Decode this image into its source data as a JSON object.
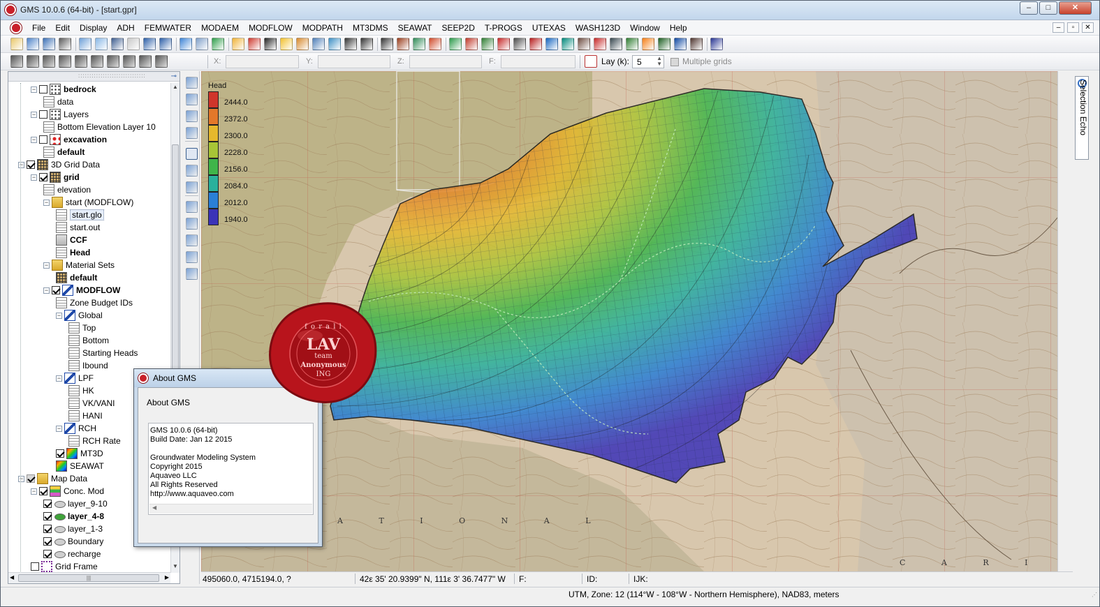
{
  "window": {
    "title": "GMS 10.0.6 (64-bit) - [start.gpr]",
    "controls": [
      "–",
      "□",
      "✕"
    ]
  },
  "menu": {
    "items": [
      "File",
      "Edit",
      "Display",
      "ADH",
      "FEMWATER",
      "MODAEM",
      "MODFLOW",
      "MODPATH",
      "MT3DMS",
      "SEAWAT",
      "SEEP2D",
      "T-PROGS",
      "UTEXAS",
      "WASH123D",
      "Window",
      "Help"
    ],
    "mdi_controls": [
      "–",
      "▫",
      "✕"
    ]
  },
  "coord_bar": {
    "x_label": "X:",
    "y_label": "Y:",
    "z_label": "Z:",
    "f_label": "F:",
    "lay_label": "Lay (k):",
    "lay_value": "5",
    "multiple_grids_label": "Multiple grids"
  },
  "tree": {
    "items": [
      {
        "label": "bedrock",
        "bold": true,
        "icon": "dots-icon",
        "checked": false
      },
      {
        "label": "data",
        "bold": false,
        "icon": "document-icon"
      },
      {
        "label": "Layers",
        "bold": false,
        "icon": "dots-icon",
        "checked": false
      },
      {
        "label": "Bottom Elevation Layer 10",
        "bold": false,
        "icon": "document-icon"
      },
      {
        "label": "excavation",
        "bold": true,
        "icon": "scatter-red-icon",
        "checked": false
      },
      {
        "label": "default",
        "bold": true,
        "icon": "document-icon"
      },
      {
        "label": "3D Grid Data",
        "bold": false,
        "icon": "grid-folder-icon",
        "checked": true
      },
      {
        "label": "grid",
        "bold": true,
        "icon": "grid-icon",
        "checked": true
      },
      {
        "label": "elevation",
        "bold": false,
        "icon": "document-icon"
      },
      {
        "label": "start (MODFLOW)",
        "bold": false,
        "icon": "folder-lock-icon"
      },
      {
        "label": "start.glo",
        "bold": false,
        "icon": "document-icon",
        "selected": true
      },
      {
        "label": "start.out",
        "bold": false,
        "icon": "document-icon"
      },
      {
        "label": "CCF",
        "bold": true,
        "icon": "ccf-icon"
      },
      {
        "label": "Head",
        "bold": true,
        "icon": "document-icon"
      },
      {
        "label": "Material Sets",
        "bold": false,
        "icon": "folder-icon"
      },
      {
        "label": "default",
        "bold": true,
        "icon": "material-grid-icon"
      },
      {
        "label": "MODFLOW",
        "bold": true,
        "icon": "modflow-icon",
        "checked": true
      },
      {
        "label": "Zone Budget IDs",
        "bold": false,
        "icon": "document-icon"
      },
      {
        "label": "Global",
        "bold": false,
        "icon": "modflow-package-icon"
      },
      {
        "label": "Top",
        "bold": false,
        "icon": "document-icon"
      },
      {
        "label": "Bottom",
        "bold": false,
        "icon": "document-icon"
      },
      {
        "label": "Starting Heads",
        "bold": false,
        "icon": "document-icon"
      },
      {
        "label": "Ibound",
        "bold": false,
        "icon": "document-icon"
      },
      {
        "label": "LPF",
        "bold": false,
        "icon": "modflow-package-icon"
      },
      {
        "label": "HK",
        "bold": false,
        "icon": "document-icon"
      },
      {
        "label": "VK/VANI",
        "bold": false,
        "icon": "document-icon"
      },
      {
        "label": "HANI",
        "bold": false,
        "icon": "document-icon"
      },
      {
        "label": "RCH",
        "bold": false,
        "icon": "modflow-package-icon"
      },
      {
        "label": "RCH Rate",
        "bold": false,
        "icon": "document-icon"
      },
      {
        "label": "MT3D",
        "bold": false,
        "icon": "mt3d-icon",
        "checked": true
      },
      {
        "label": "SEAWAT",
        "bold": false,
        "icon": "seawat-icon"
      },
      {
        "label": "Map Data",
        "bold": false,
        "icon": "map-folder-icon",
        "checked": "partial"
      },
      {
        "label": "Conc. Mod",
        "bold": false,
        "icon": "coverage-stack-icon",
        "checked": true
      },
      {
        "label": "layer_9-10",
        "bold": false,
        "icon": "coverage-icon",
        "checked": true
      },
      {
        "label": "layer_4-8",
        "bold": true,
        "icon": "coverage-active-icon",
        "checked": true
      },
      {
        "label": "layer_1-3",
        "bold": false,
        "icon": "coverage-icon",
        "checked": true
      },
      {
        "label": "Boundary",
        "bold": false,
        "icon": "coverage-icon",
        "checked": true
      },
      {
        "label": "recharge",
        "bold": false,
        "icon": "coverage-icon",
        "checked": true
      },
      {
        "label": "Grid Frame",
        "bold": false,
        "icon": "grid-frame-icon",
        "checked": false
      }
    ],
    "scroll_grip": "|||"
  },
  "legend": {
    "title": "Head",
    "labels": [
      "2444.0",
      "2372.0",
      "2300.0",
      "2228.0",
      "2156.0",
      "2084.0",
      "2012.0",
      "1940.0"
    ],
    "colors": [
      "#d0352b",
      "#e3782a",
      "#e6b82c",
      "#a8c536",
      "#3fb54a",
      "#2ab19c",
      "#2a7fd6",
      "#3b33b8"
    ]
  },
  "map_labels": {
    "bottom_left": "A T I O N A L",
    "bottom_right": "C A R I B O U"
  },
  "seal": {
    "top_arc": "f o r   a l l",
    "line1": "LAV",
    "line2": "team",
    "line3": "Anonymous",
    "line4": "ING",
    "color": "#b8141c"
  },
  "about_dialog": {
    "title": "About GMS",
    "heading": "About GMS",
    "lines": [
      "GMS 10.0.6 (64-bit)",
      "Build Date: Jan 12 2015",
      "",
      "Groundwater Modeling System",
      "Copyright 2015",
      "Aquaveo LLC",
      "All Rights Reserved",
      "http://www.aquaveo.com"
    ]
  },
  "status": {
    "coords": "495060.0, 4715194.0, ?",
    "latlon": "42ε 35' 20.9399\" N, 111ε 3' 36.7477\" W",
    "f_label": "F:",
    "id_label": "ID:",
    "ijk_label": "IJK:",
    "projection": "UTM,  Zone: 12 (114°W - 108°W - Northern Hemisphere),  NAD83,  meters"
  },
  "selection_echo": "Selection Echo",
  "colors": {
    "accent": "#c8202a",
    "titlebar": "#c2d6ec"
  }
}
